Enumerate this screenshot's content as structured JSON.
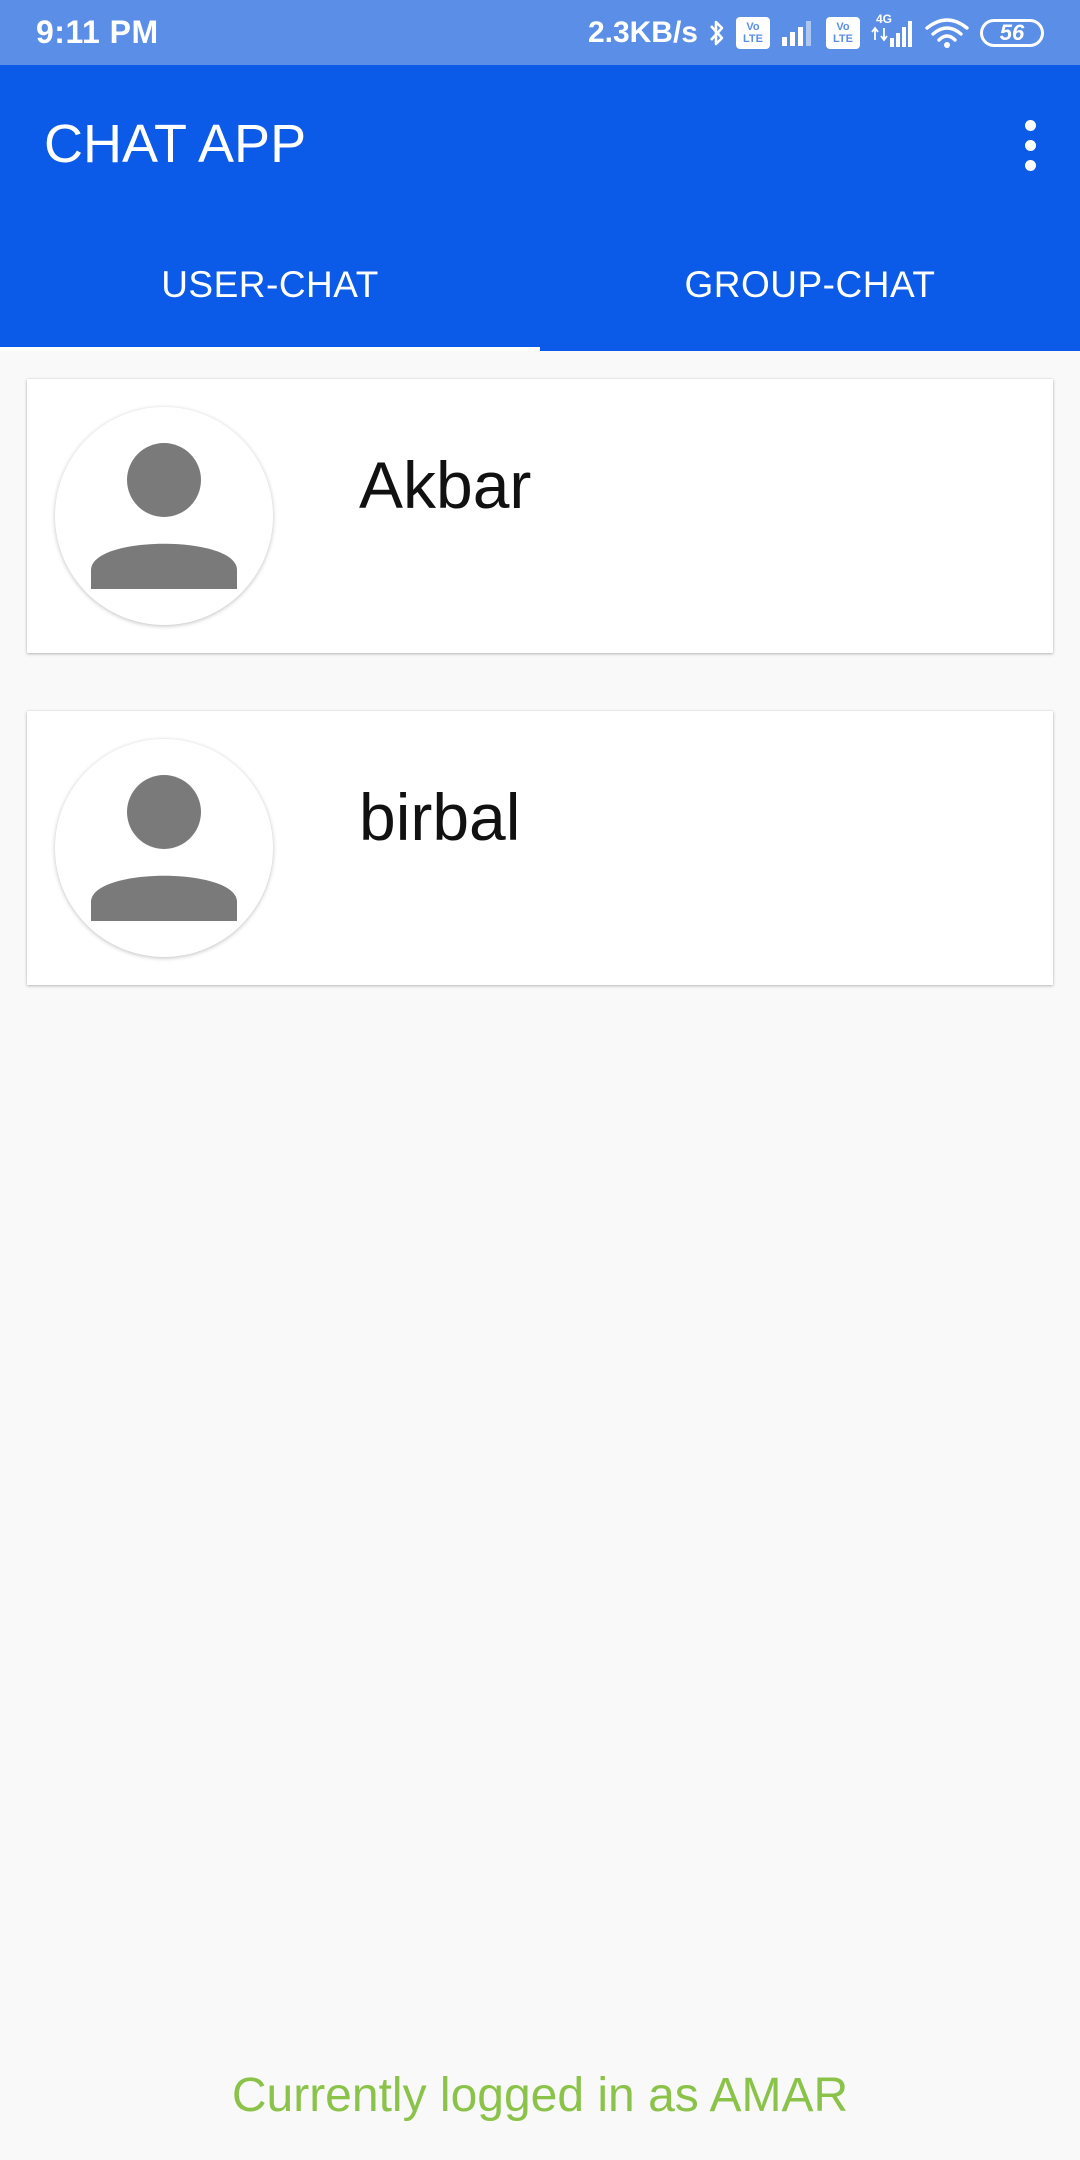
{
  "status_bar": {
    "time": "9:11 PM",
    "network_speed": "2.3KB/s",
    "volte_1": [
      "Vo",
      "LTE"
    ],
    "volte_2": [
      "Vo",
      "LTE"
    ],
    "network_type": "4G",
    "battery": "56",
    "icons": [
      "bluetooth-icon",
      "signal-icon",
      "signal-icon",
      "wifi-icon"
    ]
  },
  "app_bar": {
    "title": "CHAT APP",
    "menu_icon": "more-vert-icon"
  },
  "tabs": [
    {
      "label": "USER-CHAT",
      "selected": true
    },
    {
      "label": "GROUP-CHAT",
      "selected": false
    }
  ],
  "chats": [
    {
      "name": "Akbar",
      "avatar_icon": "person-icon"
    },
    {
      "name": "birbal",
      "avatar_icon": "person-icon"
    }
  ],
  "footer": {
    "status_text": "Currently logged in as AMAR"
  },
  "colors": {
    "status_bar": "#5b8ee6",
    "app_bar": "#0b5ae8",
    "footer_text": "#8bc34a",
    "avatar_fill": "#7a7a7a"
  }
}
